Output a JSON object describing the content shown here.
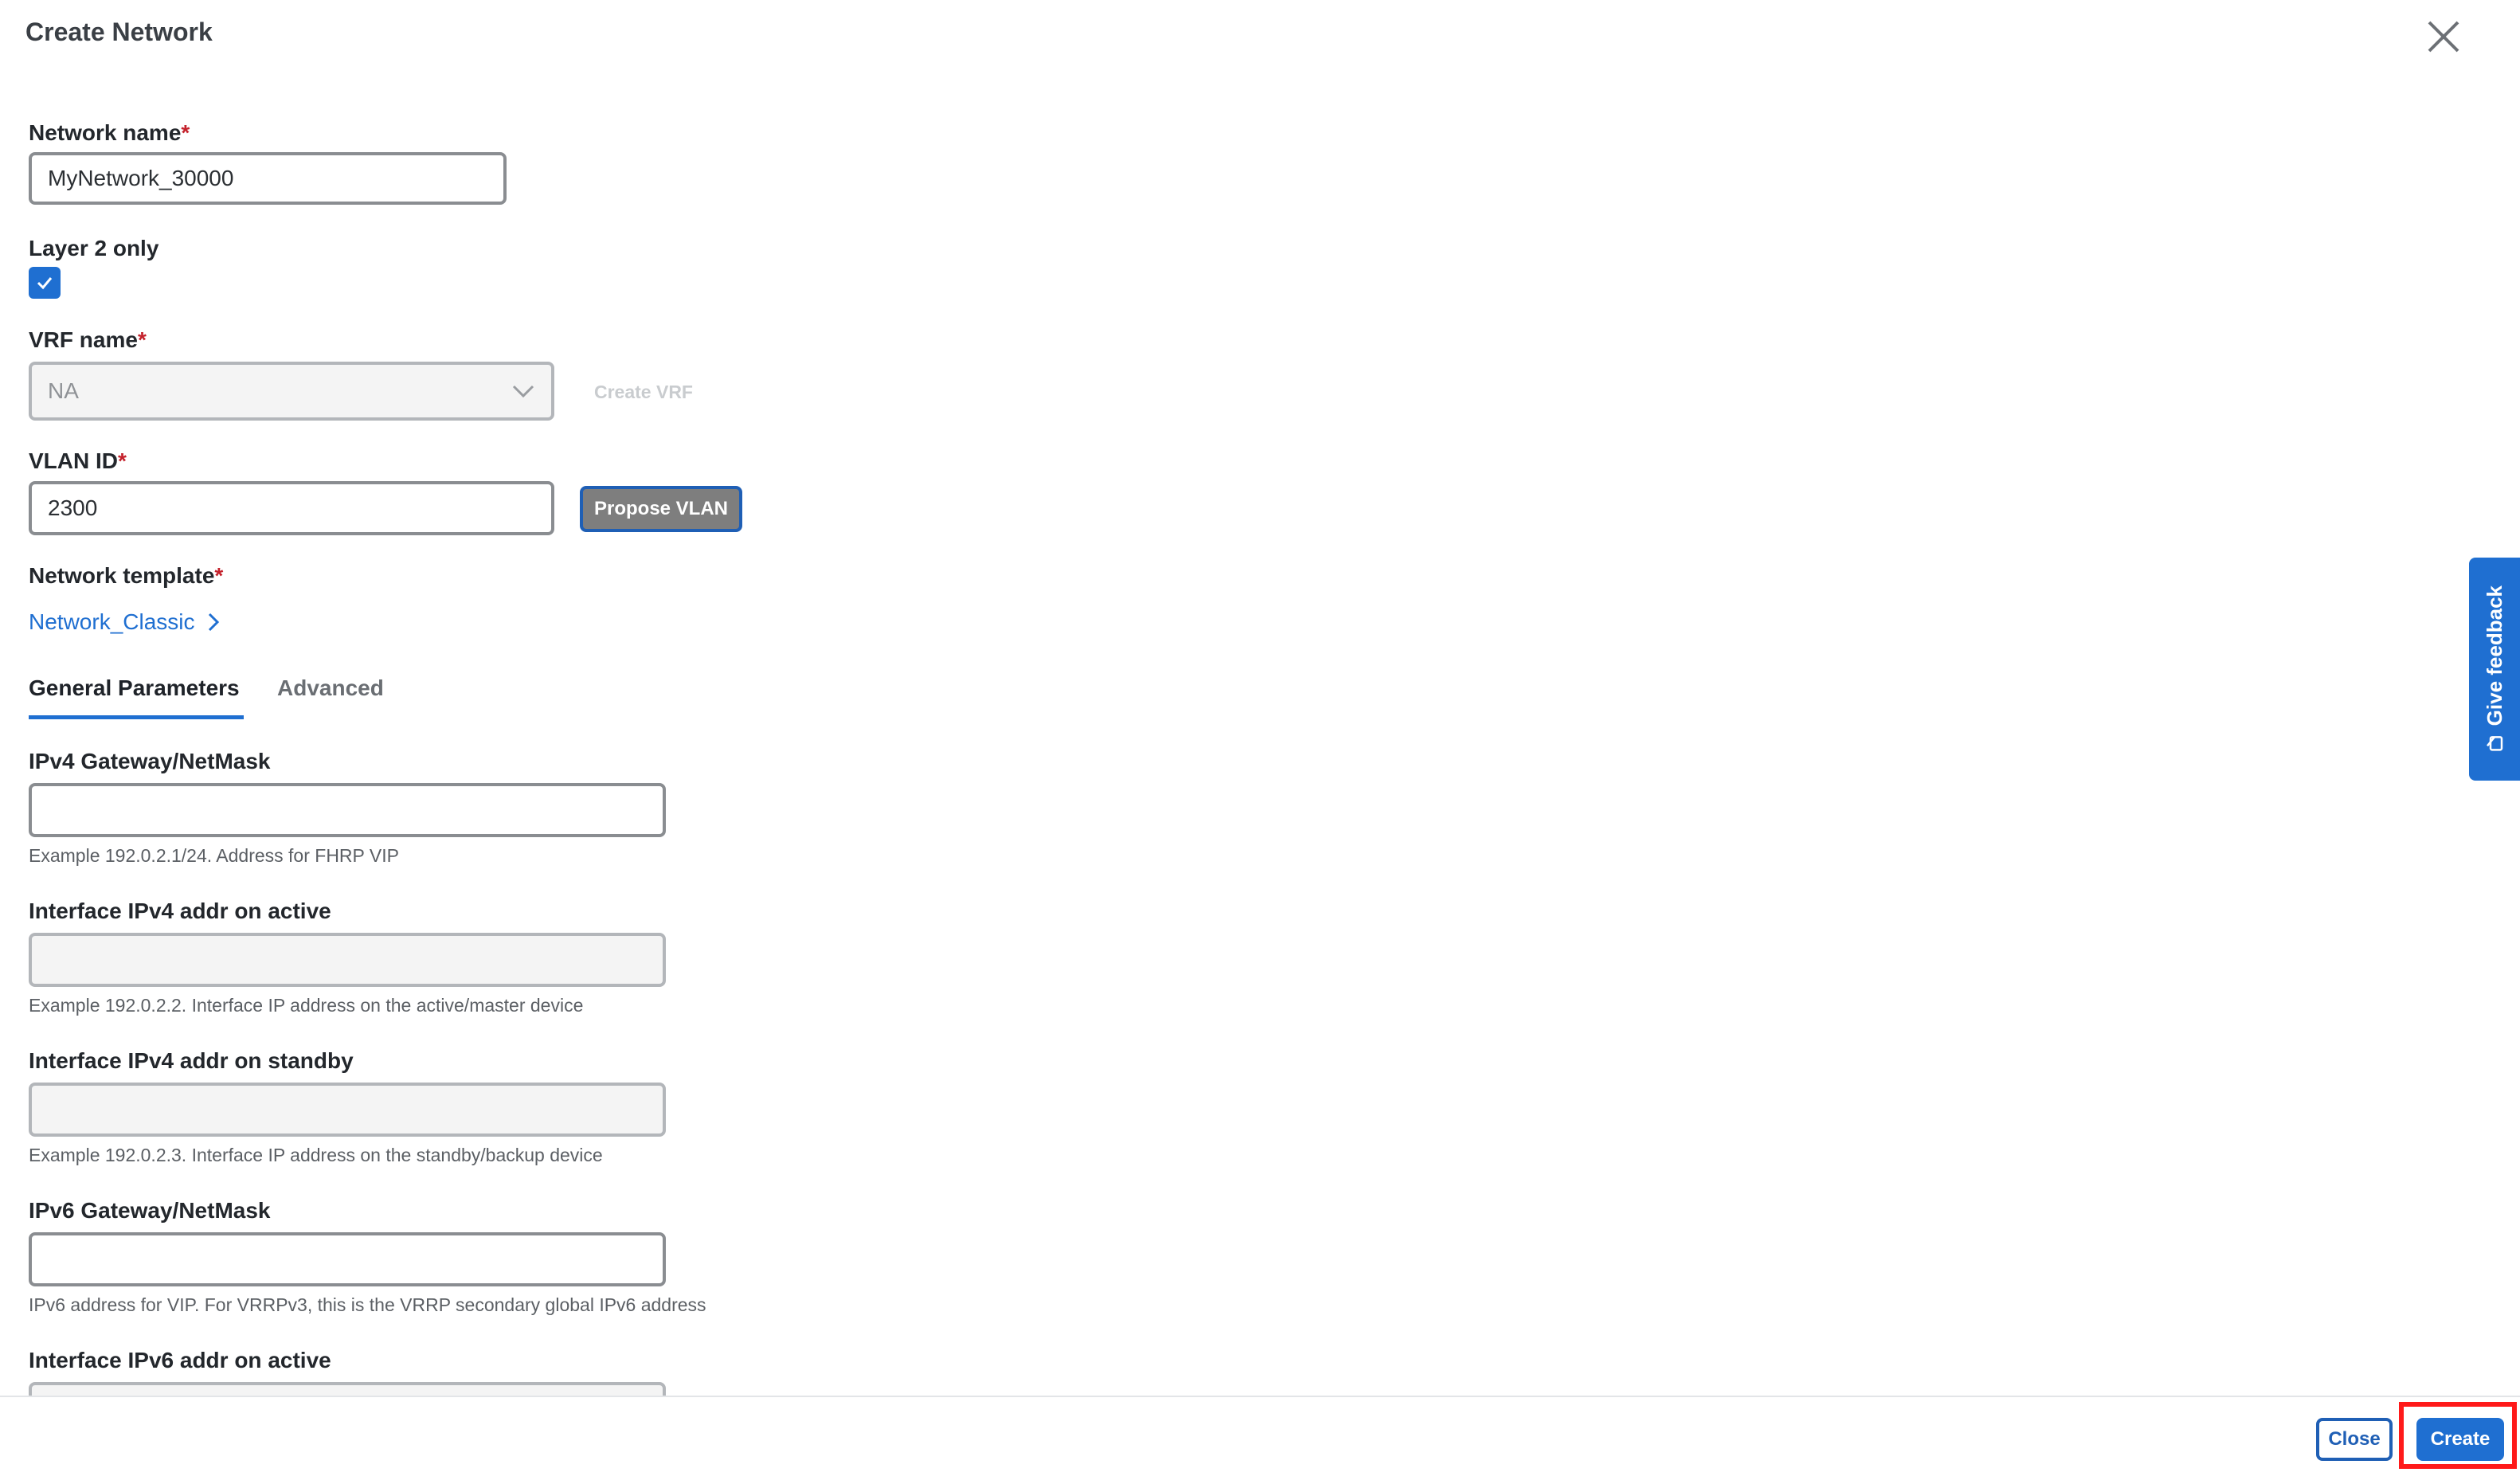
{
  "dialog": {
    "title": "Create Network"
  },
  "network_name": {
    "label": "Network name",
    "required_mark": "*",
    "value": "MyNetwork_30000"
  },
  "layer2": {
    "label": "Layer 2 only",
    "checked": true
  },
  "vrf": {
    "label": "VRF name",
    "required_mark": "*",
    "value": "NA",
    "create_link": "Create VRF"
  },
  "vlan": {
    "label": "VLAN ID",
    "required_mark": "*",
    "value": "2300",
    "propose_button": "Propose VLAN"
  },
  "template": {
    "label": "Network template",
    "required_mark": "*",
    "link": "Network_Classic"
  },
  "tabs": [
    {
      "label": "General Parameters",
      "active": true
    },
    {
      "label": "Advanced",
      "active": false
    }
  ],
  "fields": {
    "ipv4_gateway": {
      "label": "IPv4 Gateway/NetMask",
      "value": "",
      "help": "Example 192.0.2.1/24. Address for FHRP VIP"
    },
    "ipv4_active": {
      "label": "Interface IPv4 addr on active",
      "value": "",
      "help": "Example 192.0.2.2. Interface IP address on the active/master device"
    },
    "ipv4_standby": {
      "label": "Interface IPv4 addr on standby",
      "value": "",
      "help": "Example 192.0.2.3. Interface IP address on the standby/backup device"
    },
    "ipv6_gateway": {
      "label": "IPv6 Gateway/NetMask",
      "value": "",
      "help": "IPv6 address for VIP. For VRRPv3, this is the VRRP secondary global IPv6 address"
    },
    "ipv6_active": {
      "label": "Interface IPv6 addr on active",
      "value": ""
    }
  },
  "footer": {
    "close_label": "Close",
    "create_label": "Create"
  },
  "feedback": {
    "label": "Give feedback"
  },
  "colors": {
    "accent": "#1f6fd1",
    "required": "#c4212b",
    "highlight": "#ff1a1a"
  }
}
